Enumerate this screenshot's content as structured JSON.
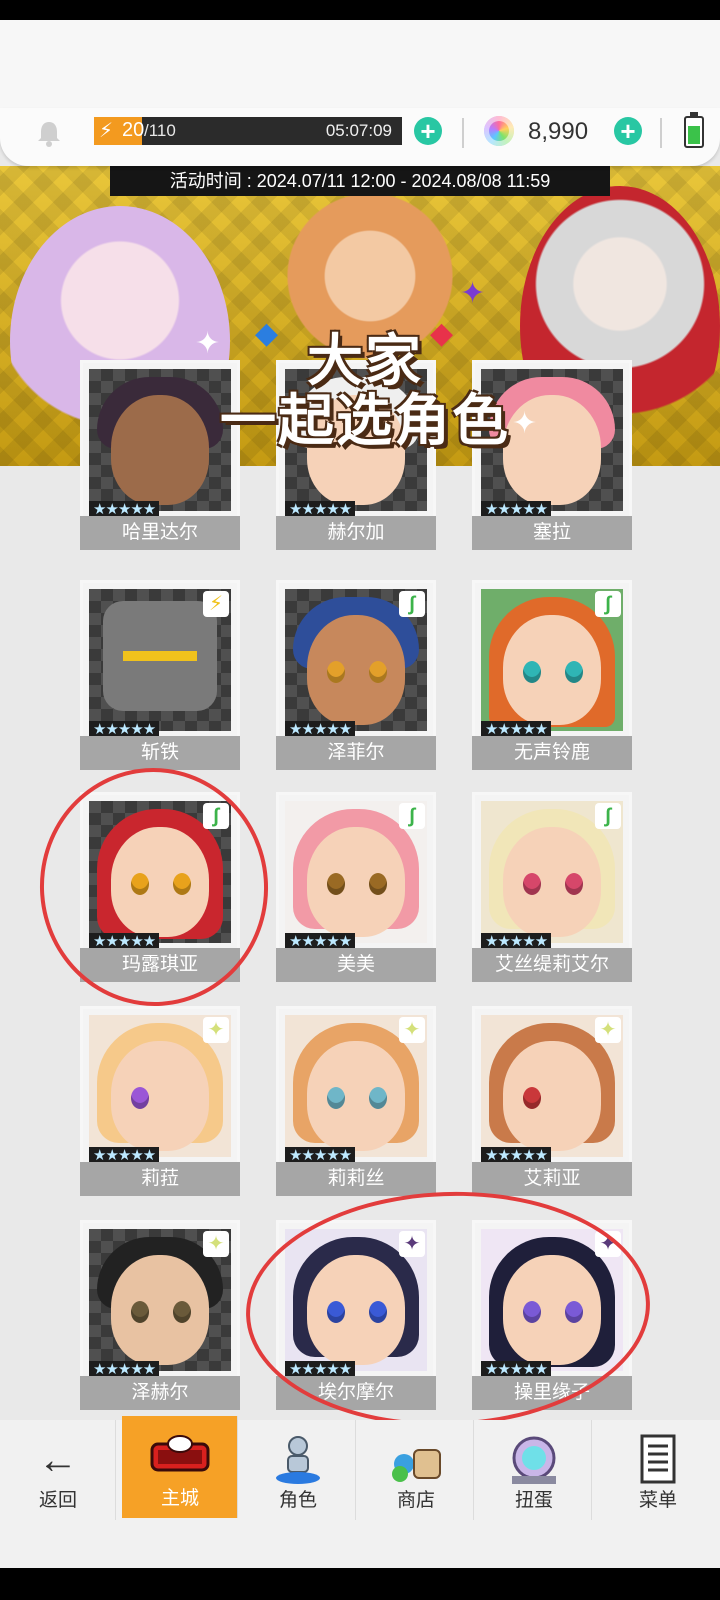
{
  "header": {
    "stamina_current": "20",
    "stamina_max": "/110",
    "stamina_timer": "05:07:09",
    "gem_count": "8,990"
  },
  "banner": {
    "event_time": "活动时间 : 2024.07/11 12:00 - 2024.08/08 11:59",
    "title_line1": "大家",
    "title_line2": "一起选角色"
  },
  "characters": [
    {
      "name": "哈里达尔",
      "stars": "★★★★★"
    },
    {
      "name": "赫尔加",
      "stars": "★★★★★"
    },
    {
      "name": "塞拉",
      "stars": "★★★★★"
    },
    {
      "name": "斩铁",
      "stars": "★★★★★"
    },
    {
      "name": "泽菲尔",
      "stars": "★★★★★"
    },
    {
      "name": "无声铃鹿",
      "stars": "★★★★★"
    },
    {
      "name": "玛露琪亚",
      "stars": "★★★★★"
    },
    {
      "name": "美美",
      "stars": "★★★★★"
    },
    {
      "name": "艾丝缇莉艾尔",
      "stars": "★★★★★"
    },
    {
      "name": "莉菈",
      "stars": "★★★★★"
    },
    {
      "name": "莉莉丝",
      "stars": "★★★★★"
    },
    {
      "name": "艾莉亚",
      "stars": "★★★★★"
    },
    {
      "name": "泽赫尔",
      "stars": "★★★★★"
    },
    {
      "name": "埃尔摩尔",
      "stars": "★★★★★"
    },
    {
      "name": "操里缘子",
      "stars": "★★★★★"
    }
  ],
  "nav": {
    "back": "返回",
    "home": "主城",
    "characters": "角色",
    "shop": "商店",
    "gacha": "扭蛋",
    "menu": "菜单"
  }
}
